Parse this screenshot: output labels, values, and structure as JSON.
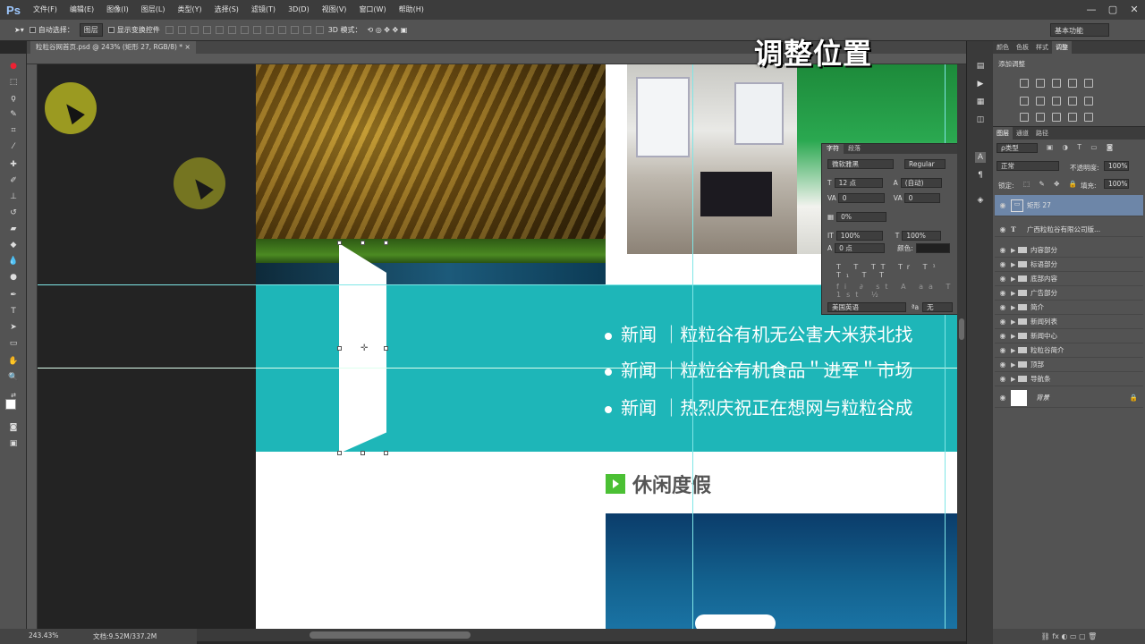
{
  "app": {
    "logo": "Ps"
  },
  "menu": [
    "文件(F)",
    "编辑(E)",
    "图像(I)",
    "图层(L)",
    "类型(Y)",
    "选择(S)",
    "滤镜(T)",
    "3D(D)",
    "视图(V)",
    "窗口(W)",
    "帮助(H)"
  ],
  "window_controls": {
    "minimize": "—",
    "restore": "▢",
    "close": "✕"
  },
  "options": {
    "auto_select_label": "自动选择：",
    "auto_select_value": "图层",
    "show_transform_label": "显示变换控件",
    "mode_3d_label": "3D 模式：",
    "workspace": "基本功能"
  },
  "document": {
    "tab_title": "粒粒谷网首页.psd @ 243% (矩形 27, RGB/8) *",
    "close": "×"
  },
  "status": {
    "zoom": "243.43%",
    "doc_size": "文档:9.52M/337.2M"
  },
  "caption": "调整位置",
  "canvas": {
    "news": [
      "新闻 ｜粒粒谷有机无公害大米获北找",
      "新闻 ｜粒粒谷有机食品＂进军＂市场",
      "新闻 ｜热烈庆祝正在想网与粒粒谷成"
    ],
    "section_title": "休闲度假",
    "colors": {
      "teal": "#1eb6b8",
      "green_icon": "#4bc034",
      "guide": "#7fe6e6"
    }
  },
  "character_panel": {
    "tabs": [
      "字符",
      "段落"
    ],
    "font_family": "微软雅黑",
    "font_style": "Regular",
    "font_size": "12 点",
    "leading": "(自动)",
    "kerning": "0",
    "tracking": "0",
    "tsume": "0%",
    "vscale": "100%",
    "hscale": "100%",
    "baseline": "0 点",
    "color_label": "颜色:",
    "style_glyphs": "T T TT Tr T¹ T₁ T T",
    "opentype_glyphs": "fi ∂ st A aa T 1st ½",
    "language": "美国英语",
    "aa_label": "ªa",
    "aa_value": "无"
  },
  "adjust_panel": {
    "tabs": [
      "颜色",
      "色板",
      "样式",
      "调整"
    ],
    "title": "添加调整"
  },
  "layers_panel": {
    "tabs": [
      "图层",
      "通道",
      "路径"
    ],
    "kind_filter": "ρ类型",
    "blend_mode": "正常",
    "opacity_label": "不透明度:",
    "opacity": "100%",
    "lock_label": "锁定:",
    "fill_label": "填充:",
    "fill": "100%",
    "layers": [
      {
        "name": "矩形 27",
        "type": "shape",
        "selected": true
      },
      {
        "name": "广西粒粒谷有限公司版...",
        "type": "text"
      },
      {
        "name": "内容部分",
        "type": "group"
      },
      {
        "name": "标语部分",
        "type": "group"
      },
      {
        "name": "底部内容",
        "type": "group"
      },
      {
        "name": "广告部分",
        "type": "group"
      },
      {
        "name": "简介",
        "type": "group"
      },
      {
        "name": "新闻列表",
        "type": "group"
      },
      {
        "name": "新闻中心",
        "type": "group"
      },
      {
        "name": "粒粒谷简介",
        "type": "group"
      },
      {
        "name": "顶部",
        "type": "group"
      },
      {
        "name": "导航条",
        "type": "group"
      },
      {
        "name": "背景",
        "type": "background"
      }
    ],
    "footer_icons": "⛓ fx ◐ ▭ ▢ 🗑"
  }
}
